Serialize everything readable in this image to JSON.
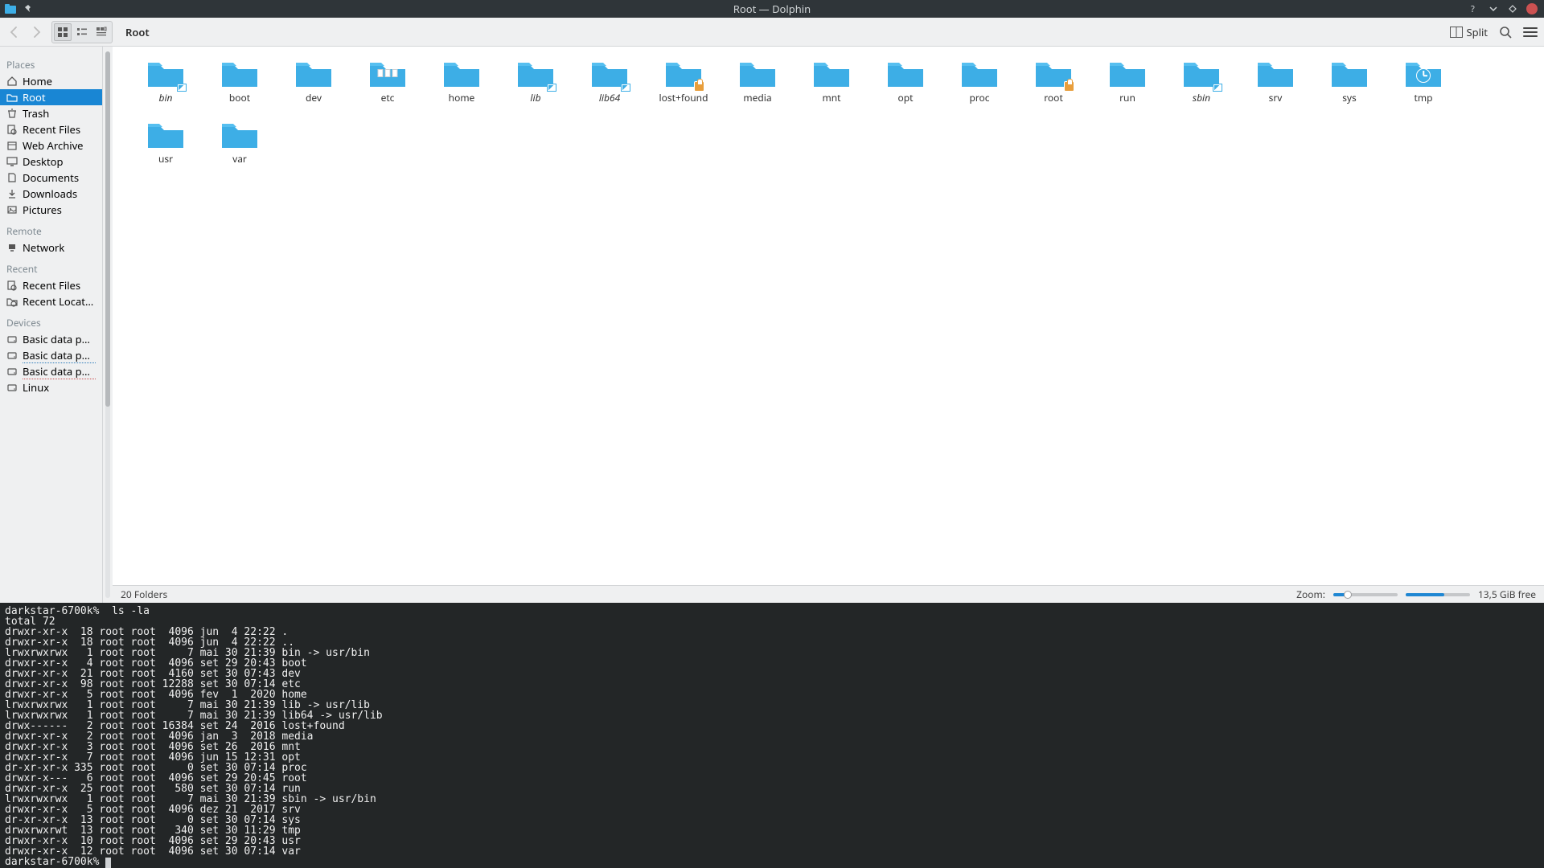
{
  "titlebar": {
    "title": "Root — Dolphin"
  },
  "toolbar": {
    "breadcrumb": "Root",
    "split": "Split"
  },
  "sidebar": {
    "sections": [
      {
        "title": "Places",
        "items": [
          {
            "label": "Home",
            "icon": "home"
          },
          {
            "label": "Root",
            "icon": "folder",
            "active": true
          },
          {
            "label": "Trash",
            "icon": "trash"
          },
          {
            "label": "Recent Files",
            "icon": "recent"
          },
          {
            "label": "Web Archive",
            "icon": "archive"
          },
          {
            "label": "Desktop",
            "icon": "desktop"
          },
          {
            "label": "Documents",
            "icon": "documents"
          },
          {
            "label": "Downloads",
            "icon": "downloads"
          },
          {
            "label": "Pictures",
            "icon": "pictures"
          }
        ]
      },
      {
        "title": "Remote",
        "items": [
          {
            "label": "Network",
            "icon": "network"
          }
        ]
      },
      {
        "title": "Recent",
        "items": [
          {
            "label": "Recent Files",
            "icon": "recent"
          },
          {
            "label": "Recent Locations",
            "icon": "location"
          }
        ]
      },
      {
        "title": "Devices",
        "items": [
          {
            "label": "Basic data partition",
            "icon": "disk"
          },
          {
            "label": "Basic data partition",
            "icon": "disk",
            "ul": 1
          },
          {
            "label": "Basic data partition",
            "icon": "disk",
            "ul": 2
          },
          {
            "label": "Linux",
            "icon": "disk"
          }
        ]
      }
    ]
  },
  "folders": [
    {
      "name": "bin",
      "italic": true,
      "overlay": "link"
    },
    {
      "name": "boot"
    },
    {
      "name": "dev"
    },
    {
      "name": "etc",
      "overlay": "etc"
    },
    {
      "name": "home"
    },
    {
      "name": "lib",
      "italic": true,
      "overlay": "link"
    },
    {
      "name": "lib64",
      "italic": true,
      "overlay": "link"
    },
    {
      "name": "lost+found",
      "overlay": "lock"
    },
    {
      "name": "media"
    },
    {
      "name": "mnt"
    },
    {
      "name": "opt"
    },
    {
      "name": "proc"
    },
    {
      "name": "root",
      "overlay": "lock"
    },
    {
      "name": "run"
    },
    {
      "name": "sbin",
      "italic": true,
      "overlay": "link"
    },
    {
      "name": "srv"
    },
    {
      "name": "sys"
    },
    {
      "name": "tmp",
      "overlay": "clock"
    },
    {
      "name": "usr"
    },
    {
      "name": "var"
    }
  ],
  "statusbar": {
    "count": "20 Folders",
    "zoom": "Zoom:",
    "diskfree": "13,5 GiB free"
  },
  "terminal": {
    "prompt": "darkstar-6700k%",
    "cmd": "ls -la",
    "lines": [
      "total 72",
      "drwxr-xr-x  18 root root  4096 jun  4 22:22 .",
      "drwxr-xr-x  18 root root  4096 jun  4 22:22 ..",
      "lrwxrwxrwx   1 root root     7 mai 30 21:39 bin -> usr/bin",
      "drwxr-xr-x   4 root root  4096 set 29 20:43 boot",
      "drwxr-xr-x  21 root root  4160 set 30 07:43 dev",
      "drwxr-xr-x  98 root root 12288 set 30 07:14 etc",
      "drwxr-xr-x   5 root root  4096 fev  1  2020 home",
      "lrwxrwxrwx   1 root root     7 mai 30 21:39 lib -> usr/lib",
      "lrwxrwxrwx   1 root root     7 mai 30 21:39 lib64 -> usr/lib",
      "drwx------   2 root root 16384 set 24  2016 lost+found",
      "drwxr-xr-x   2 root root  4096 jan  3  2018 media",
      "drwxr-xr-x   3 root root  4096 set 26  2016 mnt",
      "drwxr-xr-x   7 root root  4096 jun 15 12:31 opt",
      "dr-xr-xr-x 335 root root     0 set 30 07:14 proc",
      "drwxr-x---   6 root root  4096 set 29 20:45 root",
      "drwxr-xr-x  25 root root   580 set 30 07:14 run",
      "lrwxrwxrwx   1 root root     7 mai 30 21:39 sbin -> usr/bin",
      "drwxr-xr-x   5 root root  4096 dez 21  2017 srv",
      "dr-xr-xr-x  13 root root     0 set 30 07:14 sys",
      "drwxrwxrwt  13 root root   340 set 30 11:29 tmp",
      "drwxr-xr-x  10 root root  4096 set 29 20:43 usr",
      "drwxr-xr-x  12 root root  4096 set 30 07:14 var"
    ]
  }
}
